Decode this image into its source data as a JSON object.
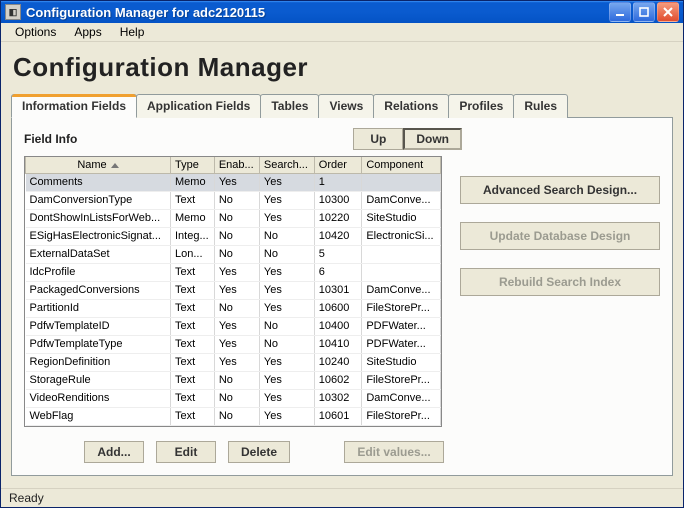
{
  "window": {
    "title": "Configuration Manager for adc2120115"
  },
  "menu": {
    "items": [
      "Options",
      "Apps",
      "Help"
    ]
  },
  "page": {
    "title": "Configuration Manager"
  },
  "tabs": {
    "items": [
      "Information Fields",
      "Application Fields",
      "Tables",
      "Views",
      "Relations",
      "Profiles",
      "Rules"
    ],
    "active_index": 0
  },
  "panel": {
    "section_label": "Field Info",
    "up_label": "Up",
    "down_label": "Down",
    "columns": [
      "Name",
      "Type",
      "Enab...",
      "Search...",
      "Order",
      "Component"
    ],
    "sorted_column_index": 0,
    "selected_row_index": 0,
    "rows": [
      {
        "name": "Comments",
        "type": "Memo",
        "enabled": "Yes",
        "searchable": "Yes",
        "order": "1",
        "component": ""
      },
      {
        "name": "DamConversionType",
        "type": "Text",
        "enabled": "No",
        "searchable": "Yes",
        "order": "10300",
        "component": "DamConve..."
      },
      {
        "name": "DontShowInListsForWeb...",
        "type": "Memo",
        "enabled": "No",
        "searchable": "Yes",
        "order": "10220",
        "component": "SiteStudio"
      },
      {
        "name": "ESigHasElectronicSignat...",
        "type": "Integ...",
        "enabled": "No",
        "searchable": "No",
        "order": "10420",
        "component": "ElectronicSi..."
      },
      {
        "name": "ExternalDataSet",
        "type": "Lon...",
        "enabled": "No",
        "searchable": "No",
        "order": "5",
        "component": ""
      },
      {
        "name": "IdcProfile",
        "type": "Text",
        "enabled": "Yes",
        "searchable": "Yes",
        "order": "6",
        "component": ""
      },
      {
        "name": "PackagedConversions",
        "type": "Text",
        "enabled": "Yes",
        "searchable": "Yes",
        "order": "10301",
        "component": "DamConve..."
      },
      {
        "name": "PartitionId",
        "type": "Text",
        "enabled": "No",
        "searchable": "Yes",
        "order": "10600",
        "component": "FileStorePr..."
      },
      {
        "name": "PdfwTemplateID",
        "type": "Text",
        "enabled": "Yes",
        "searchable": "No",
        "order": "10400",
        "component": "PDFWater..."
      },
      {
        "name": "PdfwTemplateType",
        "type": "Text",
        "enabled": "Yes",
        "searchable": "No",
        "order": "10410",
        "component": "PDFWater..."
      },
      {
        "name": "RegionDefinition",
        "type": "Text",
        "enabled": "Yes",
        "searchable": "Yes",
        "order": "10240",
        "component": "SiteStudio"
      },
      {
        "name": "StorageRule",
        "type": "Text",
        "enabled": "No",
        "searchable": "Yes",
        "order": "10602",
        "component": "FileStorePr..."
      },
      {
        "name": "VideoRenditions",
        "type": "Text",
        "enabled": "No",
        "searchable": "Yes",
        "order": "10302",
        "component": "DamConve..."
      },
      {
        "name": "WebFlag",
        "type": "Text",
        "enabled": "No",
        "searchable": "Yes",
        "order": "10601",
        "component": "FileStorePr..."
      }
    ]
  },
  "side": {
    "advanced": "Advanced Search Design...",
    "update": "Update Database Design",
    "rebuild": "Rebuild Search Index"
  },
  "bottom": {
    "add": "Add...",
    "edit": "Edit",
    "delete": "Delete",
    "edit_values": "Edit values..."
  },
  "status": {
    "text": "Ready"
  }
}
